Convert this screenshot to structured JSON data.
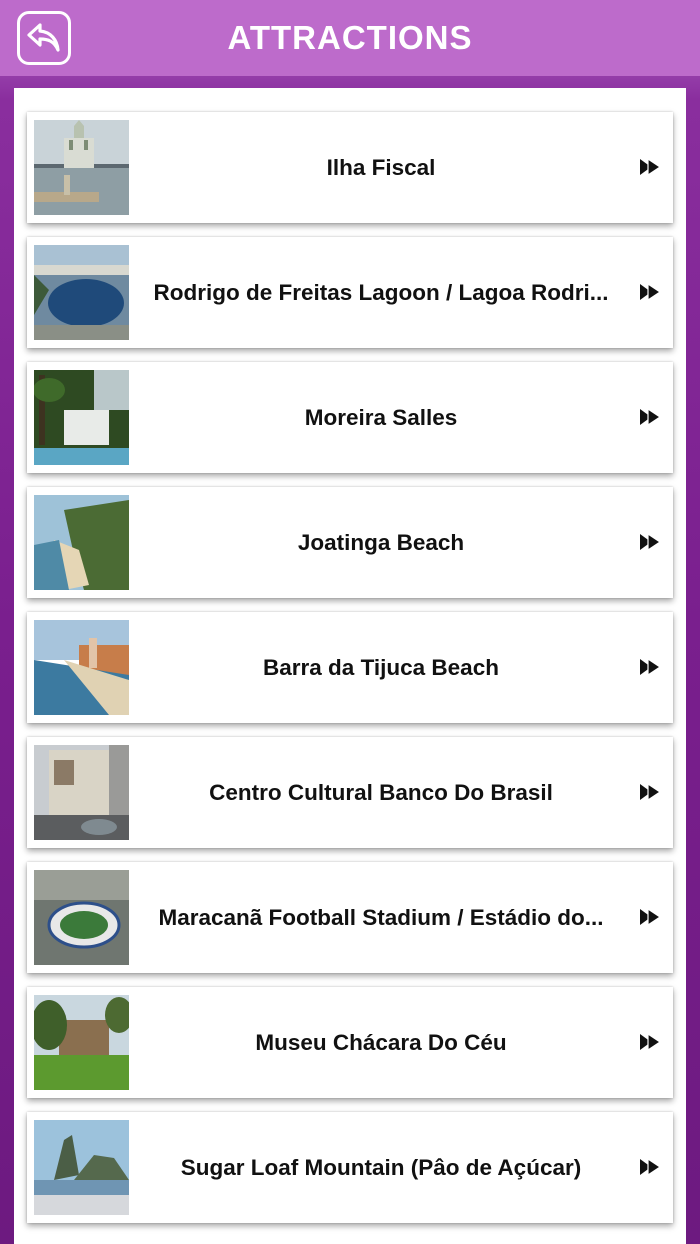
{
  "header": {
    "title": "ATTRACTIONS",
    "back_icon": "back-arrow-icon",
    "color": "#bd6bcb"
  },
  "attractions": [
    {
      "label": "Ilha Fiscal",
      "thumb": "island-castle"
    },
    {
      "label": "Rodrigo de Freitas Lagoon / Lagoa Rodri...",
      "thumb": "lagoon"
    },
    {
      "label": "Moreira Salles",
      "thumb": "garden-pool"
    },
    {
      "label": "Joatinga Beach",
      "thumb": "beach-cliff"
    },
    {
      "label": "Barra da Tijuca Beach",
      "thumb": "beach-coast"
    },
    {
      "label": "Centro Cultural Banco Do Brasil",
      "thumb": "building"
    },
    {
      "label": "Maracanã Football Stadium / Estádio do...",
      "thumb": "stadium"
    },
    {
      "label": "Museu Chácara Do Céu",
      "thumb": "park-house"
    },
    {
      "label": "Sugar Loaf Mountain (Pâo de Açúcar)",
      "thumb": "mountain"
    }
  ],
  "row_icon": "double-play-arrow-icon"
}
